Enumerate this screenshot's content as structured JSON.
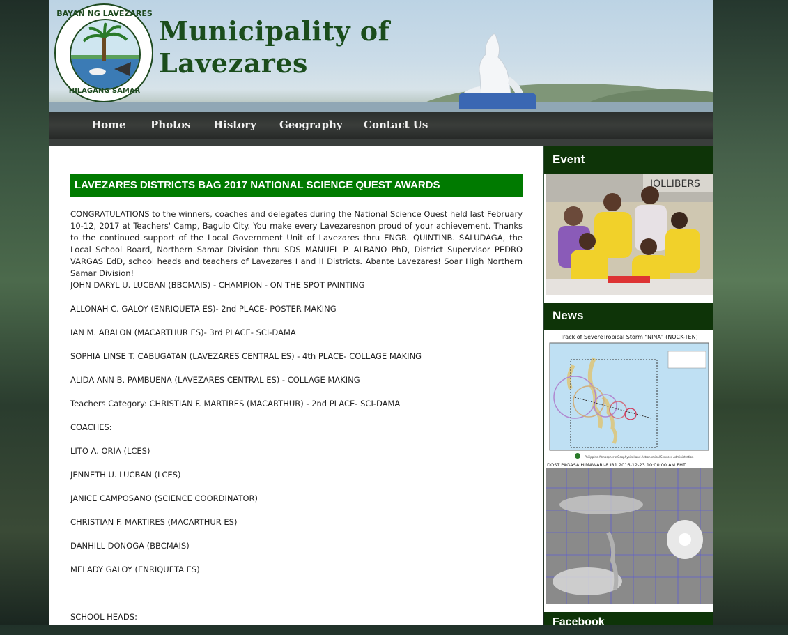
{
  "site": {
    "title_line1": "Municipality of",
    "title_line2": "Lavezares",
    "seal_top": "BAYAN NG LAVEZARES",
    "seal_bottom": "HILAGANG SAMAR"
  },
  "nav": {
    "items": [
      {
        "label": "Home"
      },
      {
        "label": "Photos"
      },
      {
        "label": "History"
      },
      {
        "label": "Geography"
      },
      {
        "label": "Contact Us"
      }
    ]
  },
  "post": {
    "title": "LAVEZARES DISTRICTS BAG 2017 NATIONAL SCIENCE QUEST AWARDS",
    "intro": "CONGRATULATIONS to the winners, coaches and delegates during the National Science Quest held last February 10-12, 2017 at Teachers' Camp, Baguio City. You make every Lavezaresnon proud of your achievement. Thanks to the continued support of the Local Government Unit of Lavezares thru ENGR. QUINTINB. SALUDAGA, the Local School Board, Northern Samar Division thru SDS MANUEL P. ALBANO PhD, District Supervisor PEDRO VARGAS EdD, school heads and teachers of Lavezares I and II Districts. Abante Lavezares! Soar High Northern Samar Division!",
    "lines": [
      "JOHN DARYL U. LUCBAN (BBCMAIS) - CHAMPION - ON THE SPOT PAINTING",
      "ALLONAH C. GALOY (ENRIQUETA ES)- 2nd PLACE- POSTER MAKING",
      "IAN M. ABALON (MACARTHUR ES)- 3rd PLACE- SCI-DAMA",
      "SOPHIA LINSE T. CABUGATAN (LAVEZARES CENTRAL ES) - 4th PLACE- COLLAGE MAKING",
      "ALIDA ANN B. PAMBUENA (LAVEZARES CENTRAL ES) - COLLAGE MAKING",
      "Teachers Category: CHRISTIAN F. MARTIRES (MACARTHUR) - 2nd PLACE- SCI-DAMA",
      "COACHES:",
      "LITO A. ORIA (LCES)",
      "JENNETH U. LUCBAN (LCES)",
      "JANICE CAMPOSANO (SCIENCE COORDINATOR)",
      "CHRISTIAN F. MARTIRES (MACARTHUR ES)",
      "DANHILL DONOGA (BBCMAIS)",
      "MELADY GALOY (ENRIQUETA ES)",
      "SCHOOL HEADS:"
    ]
  },
  "sidebar": {
    "event_title": "Event",
    "news_title": "News",
    "facebook_title": "Facebook",
    "news_map_title": "Track of SevereTropical Storm \"NINA\" (NOCK-TEN)",
    "news_map_footer": "Philippine Atmospheric Geophysical and Astronomical Services Administration",
    "news_sat_label": "DOST PAGASA HIMAWARI-8 IR1 2016-12-23 10:00:00 AM PHT",
    "event_banner_text": "JOLLIBERS"
  },
  "colors": {
    "title_green": "#007a00",
    "widget_green": "#0e3408",
    "brand_text": "#1b4d1c"
  }
}
